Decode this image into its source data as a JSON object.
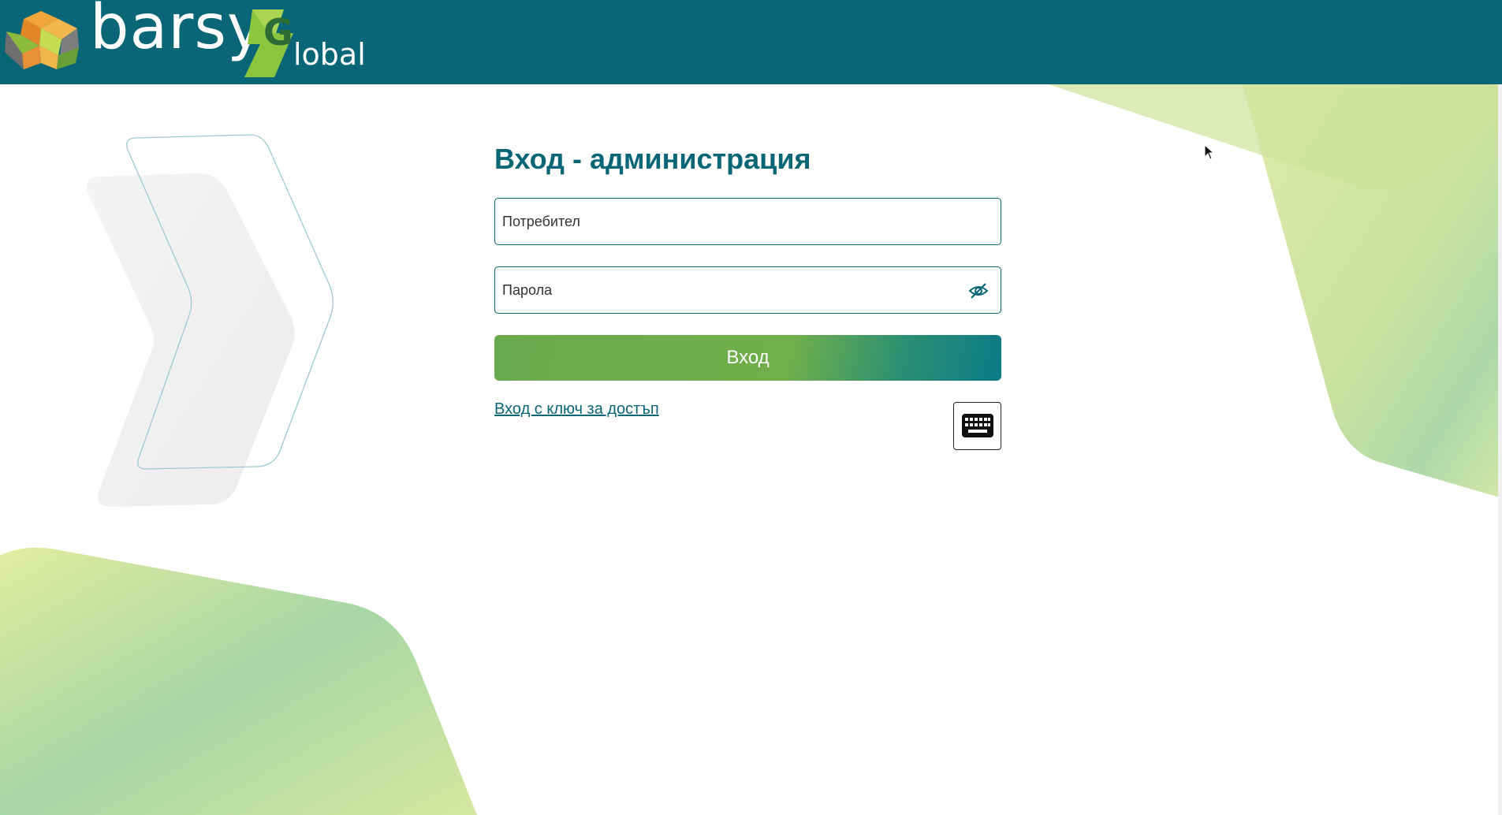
{
  "header": {
    "logo": {
      "text_main": "barsy",
      "text_g": "G",
      "text_suffix": "lobal"
    }
  },
  "login": {
    "title": "Вход - администрация",
    "username_placeholder": "Потребител",
    "password_placeholder": "Парола",
    "submit_label": "Вход",
    "access_key_link": "Вход с ключ за достъп"
  },
  "icons": {
    "password_toggle": "eye-slash-icon",
    "keyboard": "keyboard-icon"
  },
  "colors": {
    "header_bg": "#086676",
    "accent": "#086676",
    "button_green": "#6aaa4f",
    "button_teal": "#0b7b86"
  }
}
